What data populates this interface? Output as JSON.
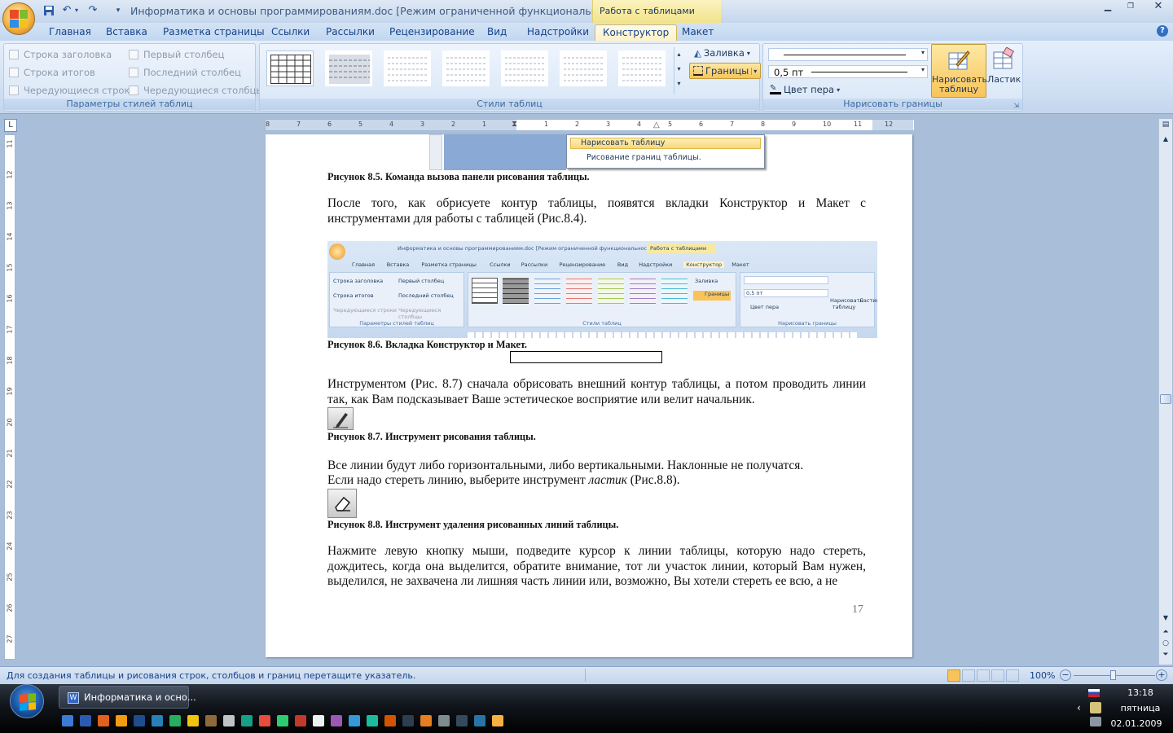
{
  "window": {
    "title": "Информатика и основы программированиям.doc [Режим ограниченной функциональности] - M...",
    "context_title": "Работа с таблицами"
  },
  "tabs": [
    "Главная",
    "Вставка",
    "Разметка страницы",
    "Ссылки",
    "Рассылки",
    "Рецензирование",
    "Вид",
    "Надстройки",
    "Конструктор",
    "Макет"
  ],
  "active_tab": "Конструктор",
  "ribbon": {
    "options": {
      "header_row": "Строка заголовка",
      "total_row": "Строка итогов",
      "banded_rows": "Чередующиеся строки",
      "first_column": "Первый столбец",
      "last_column": "Последний столбец",
      "banded_columns": "Чередующиеся столбцы",
      "group_label": "Параметры стилей таблиц"
    },
    "styles": {
      "group_label": "Стили таблиц"
    },
    "shading_label": "Заливка",
    "borders_label": "Границы",
    "draw": {
      "pen_weight": "0,5 пт",
      "pen_color": "Цвет пера",
      "draw_table": "Нарисовать таблицу",
      "eraser": "Ластик",
      "group_label": "Нарисовать границы"
    }
  },
  "document": {
    "menu_item_draw": "Нарисовать таблицу",
    "menu_item_hint": "Рисование границ таблицы.",
    "cap_85": "Рисунок 8.5. Команда вызова панели рисования таблицы.",
    "para1": "После того, как обрисуете контур таблицы, появятся вкладки Конструктор и Макет с инструментами для работы с таблицей (Рис.8.4).",
    "cap_86": "Рисунок 8.6. Вкладка Конструктор и Макет.",
    "para2": "Инструментом (Рис. 8.7) сначала обрисовать внешний контур таблицы, а потом проводить линии так, как Вам подсказывает Ваше эстетическое восприятие или велит начальник.",
    "cap_87": "Рисунок 8.7. Инструмент рисования таблицы.",
    "para3a": "Все линии будут либо горизонтальными, либо вертикальными. Наклонные не получатся.",
    "para3b_pre": "Если надо стереть линию, выберите инструмент ",
    "para3b_em": "ластик",
    "para3b_post": " (Рис.8.8).",
    "cap_88": "Рисунок 8.8. Инструмент удаления рисованных линий таблицы.",
    "para4": "Нажмите левую кнопку мыши, подведите курсор к линии таблицы, которую надо стереть, дождитесь, когда она выделится, обратите внимание, тот ли участок линии, который Вам нужен, выделился, не захвачена ли лишняя часть линии или, возможно, Вы хотели стереть ее всю, а не",
    "page_number": "17"
  },
  "embedded_screenshot": {
    "title": "Информатика и основы программированиям.doc [Режим ограниченной функциональности] - M...",
    "context": "Работа с таблицами",
    "tabs": [
      "Главная",
      "Вставка",
      "Разметка страницы",
      "Ссылки",
      "Рассылки",
      "Рецензирование",
      "Вид",
      "Надстройки",
      "Конструктор",
      "Макет"
    ],
    "chk1": "Строка заголовка",
    "chk2": "Первый столбец",
    "chk3": "Строка итогов",
    "chk4": "Последний столбец",
    "chk5": "Чередующиеся строки",
    "chk6": "Чередующиеся столбцы",
    "g1": "Параметры стилей таблиц",
    "g2": "Стили таблиц",
    "g3": "Нарисовать границы",
    "shade": "Заливка",
    "borders": "Границы",
    "pen": "0,5 пт",
    "color": "Цвет пера",
    "draw": "Нарисовать таблицу",
    "erase": "Ластик"
  },
  "ruler_top": [
    "8",
    "7",
    "6",
    "5",
    "4",
    "3",
    "2",
    "1",
    "1",
    "2",
    "3",
    "4",
    "5",
    "6",
    "7",
    "8",
    "9",
    "10",
    "11",
    "12"
  ],
  "ruler_left": [
    "11",
    "12",
    "13",
    "14",
    "15",
    "16",
    "17",
    "18",
    "19",
    "20",
    "21",
    "22",
    "23",
    "24",
    "25",
    "26",
    "27"
  ],
  "status": {
    "hint": "Для создания таблицы и рисования строк, столбцов и границ перетащите указатель.",
    "zoom": "100%"
  },
  "taskbar": {
    "window_button": "Информатика и осно...",
    "time": "13:18",
    "day": "пятница",
    "date": "02.01.2009"
  },
  "colors": {
    "accent": "#f8c45a",
    "ribbon": "#d8e6f7",
    "taskbar": "#11151b"
  }
}
